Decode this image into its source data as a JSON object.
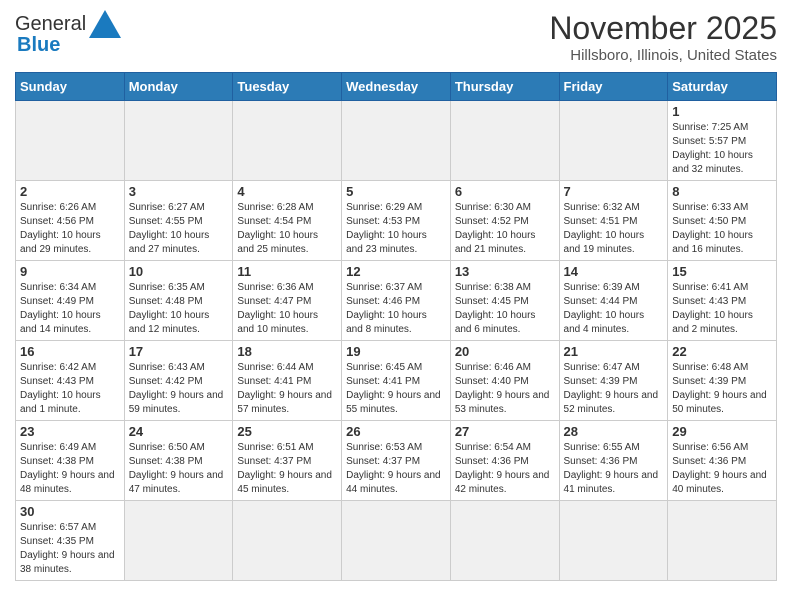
{
  "logo": {
    "general": "General",
    "blue": "Blue"
  },
  "title": "November 2025",
  "subtitle": "Hillsboro, Illinois, United States",
  "weekdays": [
    "Sunday",
    "Monday",
    "Tuesday",
    "Wednesday",
    "Thursday",
    "Friday",
    "Saturday"
  ],
  "weeks": [
    [
      {
        "day": "",
        "info": ""
      },
      {
        "day": "",
        "info": ""
      },
      {
        "day": "",
        "info": ""
      },
      {
        "day": "",
        "info": ""
      },
      {
        "day": "",
        "info": ""
      },
      {
        "day": "",
        "info": ""
      },
      {
        "day": "1",
        "info": "Sunrise: 7:25 AM\nSunset: 5:57 PM\nDaylight: 10 hours and 32 minutes."
      }
    ],
    [
      {
        "day": "2",
        "info": "Sunrise: 6:26 AM\nSunset: 4:56 PM\nDaylight: 10 hours and 29 minutes."
      },
      {
        "day": "3",
        "info": "Sunrise: 6:27 AM\nSunset: 4:55 PM\nDaylight: 10 hours and 27 minutes."
      },
      {
        "day": "4",
        "info": "Sunrise: 6:28 AM\nSunset: 4:54 PM\nDaylight: 10 hours and 25 minutes."
      },
      {
        "day": "5",
        "info": "Sunrise: 6:29 AM\nSunset: 4:53 PM\nDaylight: 10 hours and 23 minutes."
      },
      {
        "day": "6",
        "info": "Sunrise: 6:30 AM\nSunset: 4:52 PM\nDaylight: 10 hours and 21 minutes."
      },
      {
        "day": "7",
        "info": "Sunrise: 6:32 AM\nSunset: 4:51 PM\nDaylight: 10 hours and 19 minutes."
      },
      {
        "day": "8",
        "info": "Sunrise: 6:33 AM\nSunset: 4:50 PM\nDaylight: 10 hours and 16 minutes."
      }
    ],
    [
      {
        "day": "9",
        "info": "Sunrise: 6:34 AM\nSunset: 4:49 PM\nDaylight: 10 hours and 14 minutes."
      },
      {
        "day": "10",
        "info": "Sunrise: 6:35 AM\nSunset: 4:48 PM\nDaylight: 10 hours and 12 minutes."
      },
      {
        "day": "11",
        "info": "Sunrise: 6:36 AM\nSunset: 4:47 PM\nDaylight: 10 hours and 10 minutes."
      },
      {
        "day": "12",
        "info": "Sunrise: 6:37 AM\nSunset: 4:46 PM\nDaylight: 10 hours and 8 minutes."
      },
      {
        "day": "13",
        "info": "Sunrise: 6:38 AM\nSunset: 4:45 PM\nDaylight: 10 hours and 6 minutes."
      },
      {
        "day": "14",
        "info": "Sunrise: 6:39 AM\nSunset: 4:44 PM\nDaylight: 10 hours and 4 minutes."
      },
      {
        "day": "15",
        "info": "Sunrise: 6:41 AM\nSunset: 4:43 PM\nDaylight: 10 hours and 2 minutes."
      }
    ],
    [
      {
        "day": "16",
        "info": "Sunrise: 6:42 AM\nSunset: 4:43 PM\nDaylight: 10 hours and 1 minute."
      },
      {
        "day": "17",
        "info": "Sunrise: 6:43 AM\nSunset: 4:42 PM\nDaylight: 9 hours and 59 minutes."
      },
      {
        "day": "18",
        "info": "Sunrise: 6:44 AM\nSunset: 4:41 PM\nDaylight: 9 hours and 57 minutes."
      },
      {
        "day": "19",
        "info": "Sunrise: 6:45 AM\nSunset: 4:41 PM\nDaylight: 9 hours and 55 minutes."
      },
      {
        "day": "20",
        "info": "Sunrise: 6:46 AM\nSunset: 4:40 PM\nDaylight: 9 hours and 53 minutes."
      },
      {
        "day": "21",
        "info": "Sunrise: 6:47 AM\nSunset: 4:39 PM\nDaylight: 9 hours and 52 minutes."
      },
      {
        "day": "22",
        "info": "Sunrise: 6:48 AM\nSunset: 4:39 PM\nDaylight: 9 hours and 50 minutes."
      }
    ],
    [
      {
        "day": "23",
        "info": "Sunrise: 6:49 AM\nSunset: 4:38 PM\nDaylight: 9 hours and 48 minutes."
      },
      {
        "day": "24",
        "info": "Sunrise: 6:50 AM\nSunset: 4:38 PM\nDaylight: 9 hours and 47 minutes."
      },
      {
        "day": "25",
        "info": "Sunrise: 6:51 AM\nSunset: 4:37 PM\nDaylight: 9 hours and 45 minutes."
      },
      {
        "day": "26",
        "info": "Sunrise: 6:53 AM\nSunset: 4:37 PM\nDaylight: 9 hours and 44 minutes."
      },
      {
        "day": "27",
        "info": "Sunrise: 6:54 AM\nSunset: 4:36 PM\nDaylight: 9 hours and 42 minutes."
      },
      {
        "day": "28",
        "info": "Sunrise: 6:55 AM\nSunset: 4:36 PM\nDaylight: 9 hours and 41 minutes."
      },
      {
        "day": "29",
        "info": "Sunrise: 6:56 AM\nSunset: 4:36 PM\nDaylight: 9 hours and 40 minutes."
      }
    ],
    [
      {
        "day": "30",
        "info": "Sunrise: 6:57 AM\nSunset: 4:35 PM\nDaylight: 9 hours and 38 minutes."
      },
      {
        "day": "",
        "info": ""
      },
      {
        "day": "",
        "info": ""
      },
      {
        "day": "",
        "info": ""
      },
      {
        "day": "",
        "info": ""
      },
      {
        "day": "",
        "info": ""
      },
      {
        "day": "",
        "info": ""
      }
    ]
  ]
}
